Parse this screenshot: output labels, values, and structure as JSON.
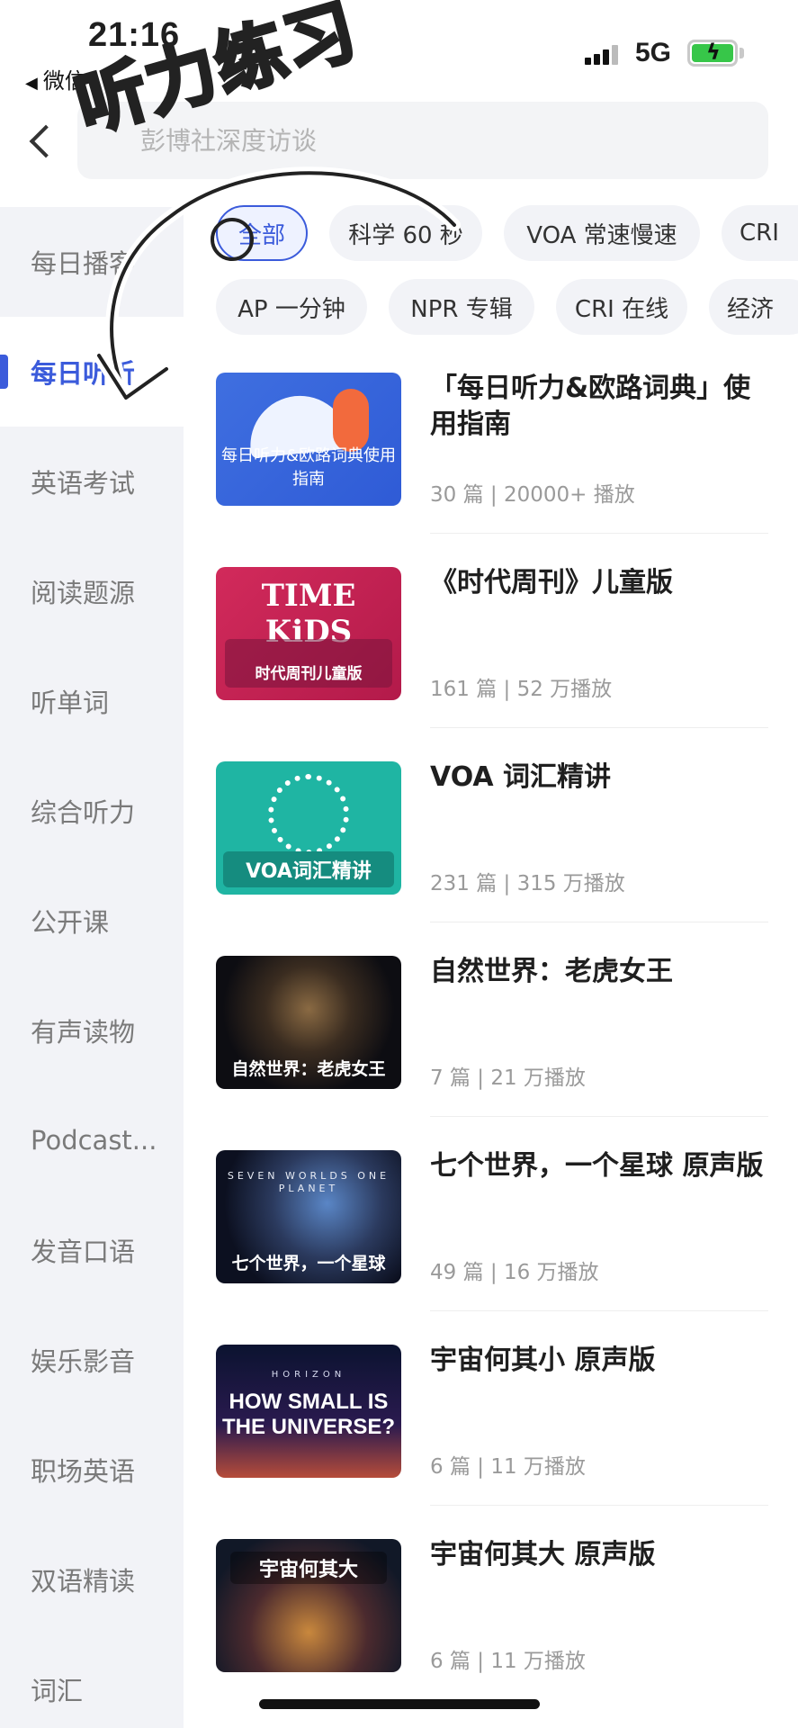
{
  "status_bar": {
    "time": "21:16",
    "back_app": "微信",
    "network": "5G",
    "battery_color": "#37c649"
  },
  "search": {
    "placeholder": "彭博社深度访谈"
  },
  "overlay": {
    "handwritten_title": "听力练习"
  },
  "sidebar": {
    "active_color": "#3b5bdb",
    "items": [
      {
        "label": "每日播客"
      },
      {
        "label": "每日听听"
      },
      {
        "label": "英语考试"
      },
      {
        "label": "阅读题源"
      },
      {
        "label": "听单词"
      },
      {
        "label": "综合听力"
      },
      {
        "label": "公开课"
      },
      {
        "label": "有声读物"
      },
      {
        "label": "Podcast..."
      },
      {
        "label": "发音口语"
      },
      {
        "label": "娱乐影音"
      },
      {
        "label": "职场英语"
      },
      {
        "label": "双语精读"
      },
      {
        "label": "词汇"
      }
    ]
  },
  "chips": {
    "row1": [
      {
        "label": "全部",
        "active": true
      },
      {
        "label": "科学 60 秒"
      },
      {
        "label": "VOA 常速慢速"
      },
      {
        "label": "CRI"
      }
    ],
    "row2": [
      {
        "label": "AP 一分钟"
      },
      {
        "label": "NPR 专辑"
      },
      {
        "label": "CRI 在线"
      },
      {
        "label": "经济"
      }
    ]
  },
  "list": [
    {
      "title": "「每日听力&欧路词典」使用指南",
      "meta": "30 篇 | 20000+ 播放",
      "thumb_caption": "每日听力&欧路词典使用指南"
    },
    {
      "title": "《时代周刊》儿童版",
      "meta": "161 篇 | 52 万播放",
      "thumb_brand": "TIME KiDS",
      "thumb_caption": "时代周刊儿童版"
    },
    {
      "title": "VOA 词汇精讲",
      "meta": "231 篇 | 315 万播放",
      "thumb_caption": "VOA词汇精讲"
    },
    {
      "title": "自然世界：老虎女王",
      "meta": "7 篇 | 21 万播放",
      "thumb_caption": "自然世界：老虎女王"
    },
    {
      "title": "七个世界，一个星球 原声版",
      "meta": "49 篇 | 16 万播放",
      "thumb_top": "SEVEN WORLDS ONE PLANET",
      "thumb_caption": "七个世界，一个星球"
    },
    {
      "title": "宇宙何其小 原声版",
      "meta": "6 篇 | 11 万播放",
      "thumb_top": "HORIZON",
      "thumb_big": "HOW SMALL IS THE UNIVERSE?"
    },
    {
      "title": "宇宙何其大 原声版",
      "meta": "6 篇 | 11 万播放",
      "thumb_caption": "宇宙何其大"
    }
  ]
}
